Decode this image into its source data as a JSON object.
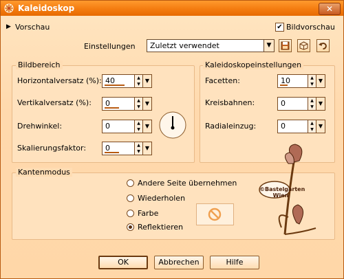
{
  "window": {
    "title": "Kaleidoskop",
    "close_label": "✕"
  },
  "preview": {
    "label": "Vorschau",
    "bildvorschau_label": "Bildvorschau",
    "bildvorschau_checked": true
  },
  "settings": {
    "label": "Einstellungen",
    "value": "Zuletzt verwendet"
  },
  "bildbereich": {
    "title": "Bildbereich",
    "fields": [
      {
        "label": "Horizontalversatz (%):",
        "value": "40",
        "level": 0.7
      },
      {
        "label": "Vertikalversatz (%):",
        "value": "0",
        "level": 0.5
      },
      {
        "label": "Drehwinkel:",
        "value": "0",
        "level": 0
      },
      {
        "label": "Skalierungsfaktor:",
        "value": "0",
        "level": 0.5
      }
    ]
  },
  "kaleido": {
    "title": "Kaleidoskopeinstellungen",
    "fields": [
      {
        "label": "Facetten:",
        "value": "10",
        "level": 0.3
      },
      {
        "label": "Kreisbahnen:",
        "value": "0",
        "level": 0
      },
      {
        "label": "Radialeinzug:",
        "value": "0",
        "level": 0
      }
    ]
  },
  "kantenmodus": {
    "title": "Kantenmodus",
    "options": [
      {
        "label": "Andere Seite übernehmen",
        "selected": false
      },
      {
        "label": "Wiederholen",
        "selected": false
      },
      {
        "label": "Farbe",
        "selected": false
      },
      {
        "label": "Reflektieren",
        "selected": true
      }
    ]
  },
  "watermark": "©Bastelgarten Wien",
  "buttons": {
    "ok": "OK",
    "cancel": "Abbrechen",
    "help": "Hilfe"
  },
  "colors": {
    "accent": "#f47c10",
    "panel": "#ffe2be",
    "dark": "#b85a10"
  }
}
